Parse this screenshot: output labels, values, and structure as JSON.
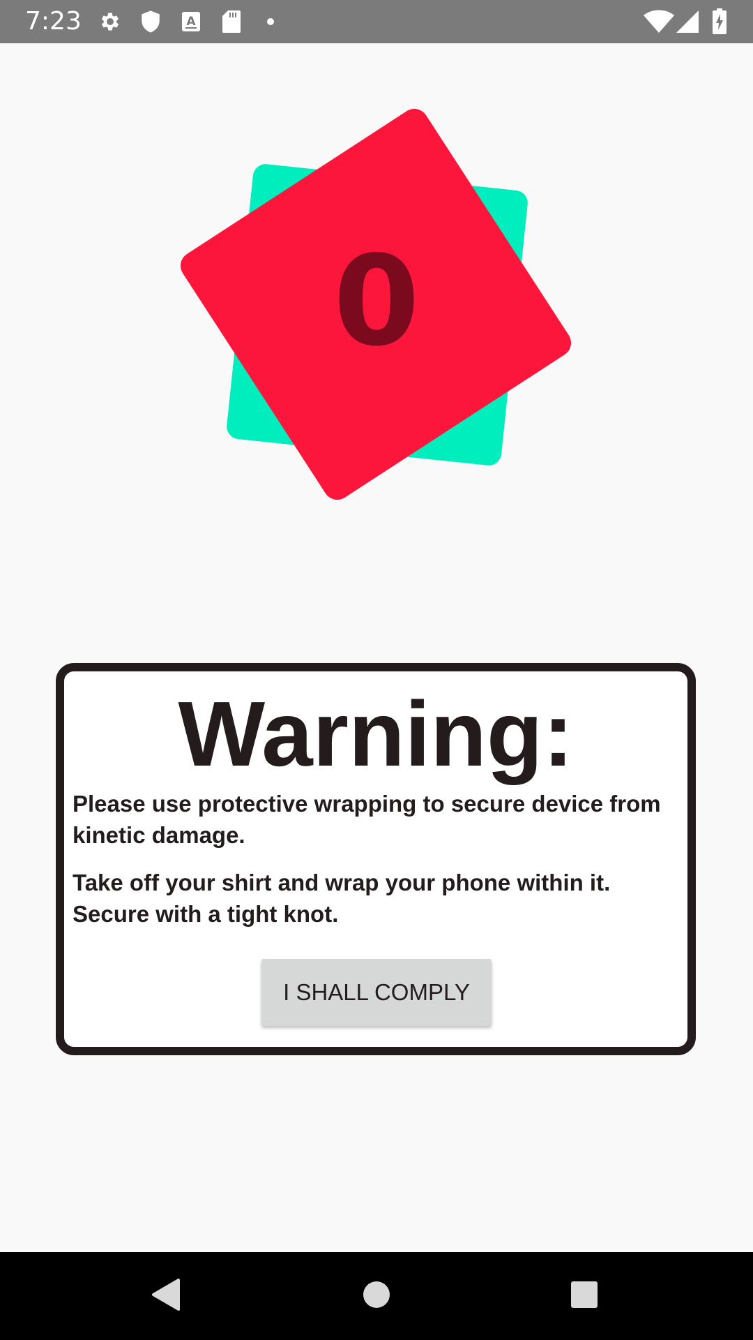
{
  "status_bar": {
    "time": "7:23",
    "icons_left": [
      "gear-icon",
      "shield-icon",
      "keyboard-a-icon",
      "sd-card-icon",
      "dot-icon"
    ],
    "icons_right": [
      "wifi-icon",
      "signal-icon",
      "battery-charging-icon"
    ]
  },
  "counter": {
    "value": "0",
    "colors": {
      "front_die": "#fd163c",
      "back_die": "#00eebe",
      "digit": "#7b0a1e"
    }
  },
  "dialog": {
    "title": "Warning:",
    "message_1": "Please use protective wrapping to secure device from kinetic damage.",
    "message_2": "Take off your shirt and wrap your phone within it. Secure with a tight knot.",
    "button_label": "I SHALL COMPLY"
  },
  "nav_bar": {
    "buttons": [
      "back-icon",
      "home-icon",
      "recents-icon"
    ]
  }
}
